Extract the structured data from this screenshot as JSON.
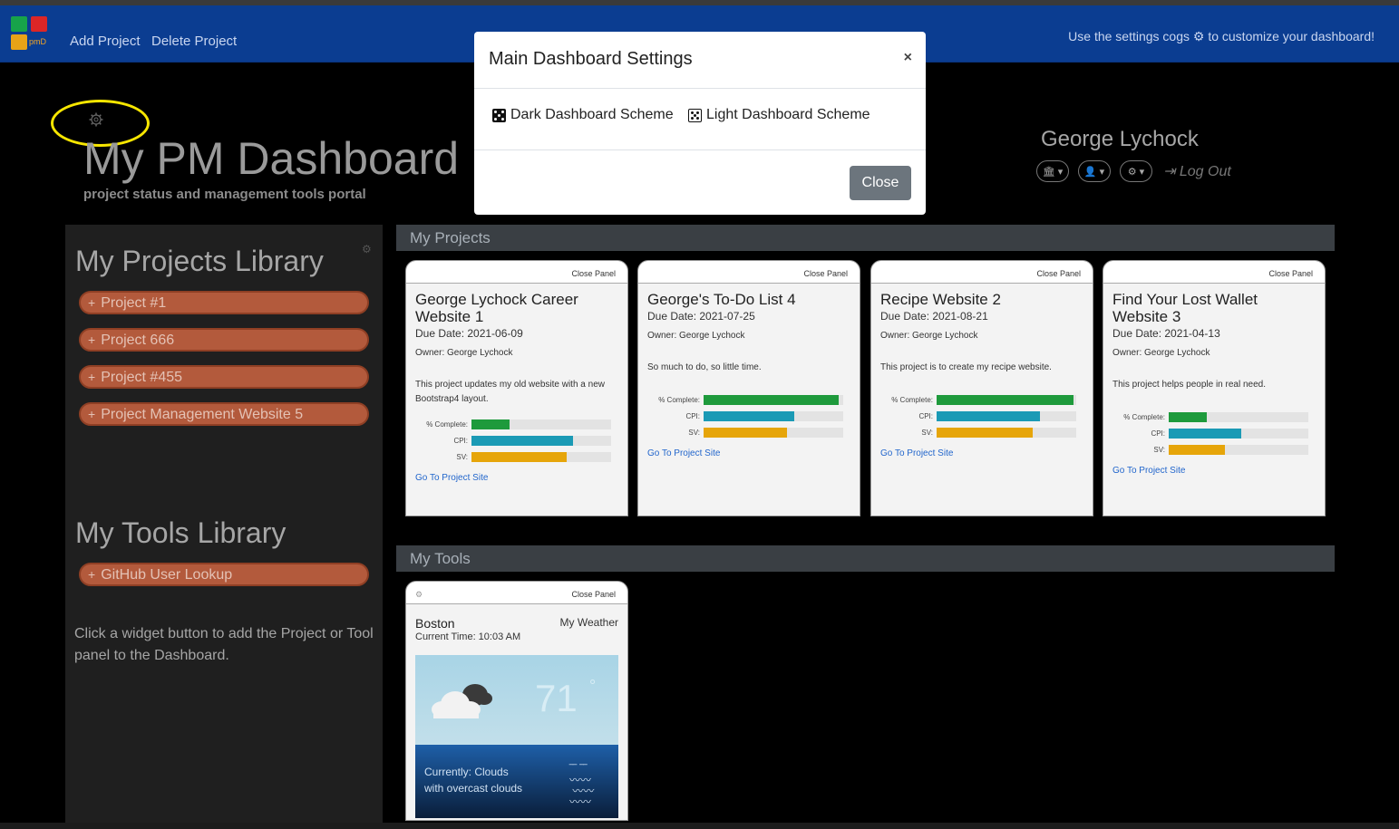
{
  "navbar": {
    "logo_text": "pmD",
    "links": [
      "Add Project",
      "Delete Project"
    ],
    "hint": "Use the settings cogs ⚙ to customize your dashboard!"
  },
  "hero": {
    "title": "My PM Dashboard",
    "subtitle": "project status and management tools portal"
  },
  "user": {
    "name": "George Lychock",
    "logout": "Log Out"
  },
  "sidebar": {
    "projects_title": "My Projects Library",
    "projects": [
      "Project #1",
      "Project 666",
      "Project #455",
      "Project Management Website 5"
    ],
    "tools_title": "My Tools Library",
    "tools": [
      "GitHub User Lookup"
    ],
    "note": "Click a widget button to add the Project or Tool panel to the Dashboard."
  },
  "sections": {
    "projects": "My Projects",
    "tools": "My Tools"
  },
  "cards": [
    {
      "close": "Close Panel",
      "title": "George Lychock Career Website 1",
      "due": "Due Date: 2021-06-09",
      "owner": "Owner: George Lychock",
      "desc": "This project updates my old website with a new Bootstrap4 layout.",
      "metrics": {
        "complete_label": "% Complete:",
        "cpi_label": "CPI:",
        "sv_label": "SV:",
        "complete": 0.27,
        "cpi": 0.73,
        "sv": 0.68
      },
      "link": "Go To Project Site"
    },
    {
      "close": "Close Panel",
      "title": "George's To-Do List 4",
      "due": "Due Date: 2021-07-25",
      "owner": "Owner: George Lychock",
      "desc": "So much to do, so little time.",
      "metrics": {
        "complete_label": "% Complete:",
        "cpi_label": "CPI:",
        "sv_label": "SV:",
        "complete": 0.97,
        "cpi": 0.65,
        "sv": 0.6
      },
      "link": "Go To Project Site"
    },
    {
      "close": "Close Panel",
      "title": "Recipe Website 2",
      "due": "Due Date: 2021-08-21",
      "owner": "Owner: George Lychock",
      "desc": "This project is to create my recipe website.",
      "metrics": {
        "complete_label": "% Complete:",
        "cpi_label": "CPI:",
        "sv_label": "SV:",
        "complete": 0.98,
        "cpi": 0.74,
        "sv": 0.69
      },
      "link": "Go To Project Site"
    },
    {
      "close": "Close Panel",
      "title": "Find Your Lost Wallet Website 3",
      "due": "Due Date: 2021-04-13",
      "owner": "Owner: George Lychock",
      "desc": "This project helps people in real need.",
      "metrics": {
        "complete_label": "% Complete:",
        "cpi_label": "CPI:",
        "sv_label": "SV:",
        "complete": 0.27,
        "cpi": 0.52,
        "sv": 0.4
      },
      "link": "Go To Project Site"
    }
  ],
  "colors": {
    "complete": "#1e9a3c",
    "cpi": "#1b9ab5",
    "sv": "#e6a50a"
  },
  "weather": {
    "close": "Close Panel",
    "city": "Boston",
    "label": "My Weather",
    "time": "Current Time: 10:03 AM",
    "temp": "71",
    "deg": "°",
    "current": "Currently: Clouds",
    "detail": "with overcast clouds"
  },
  "modal": {
    "title": "Main Dashboard Settings",
    "x": "×",
    "dark": "Dark Dashboard Scheme",
    "light": "Light Dashboard Scheme",
    "close": "Close"
  }
}
